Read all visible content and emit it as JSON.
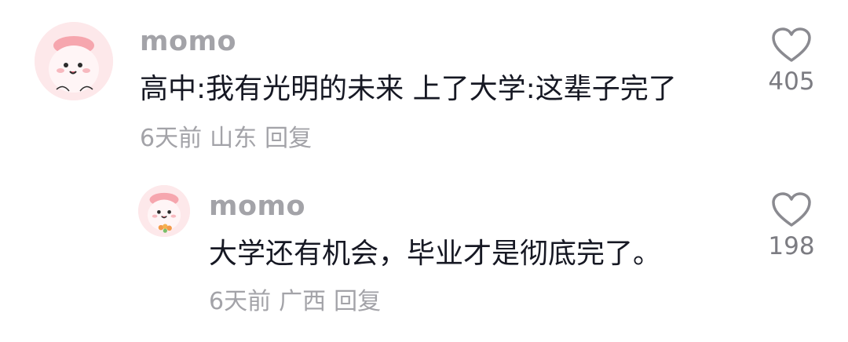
{
  "comments": [
    {
      "username": "momo",
      "text": "高中:我有光明的未来 上了大学:这辈子完了",
      "time": "6天前",
      "location": "山东",
      "reply_label": "回复",
      "likes": "405",
      "like_icon": "heart-outline-icon"
    },
    {
      "username": "momo",
      "text": "大学还有机会，毕业才是彻底完了。",
      "time": "6天前",
      "location": "广西",
      "reply_label": "回复",
      "likes": "198",
      "like_icon": "heart-outline-icon"
    }
  ],
  "colors": {
    "text_primary": "#161823",
    "text_secondary": "#a3a3a8",
    "avatar_bg": "#fde8ea"
  }
}
